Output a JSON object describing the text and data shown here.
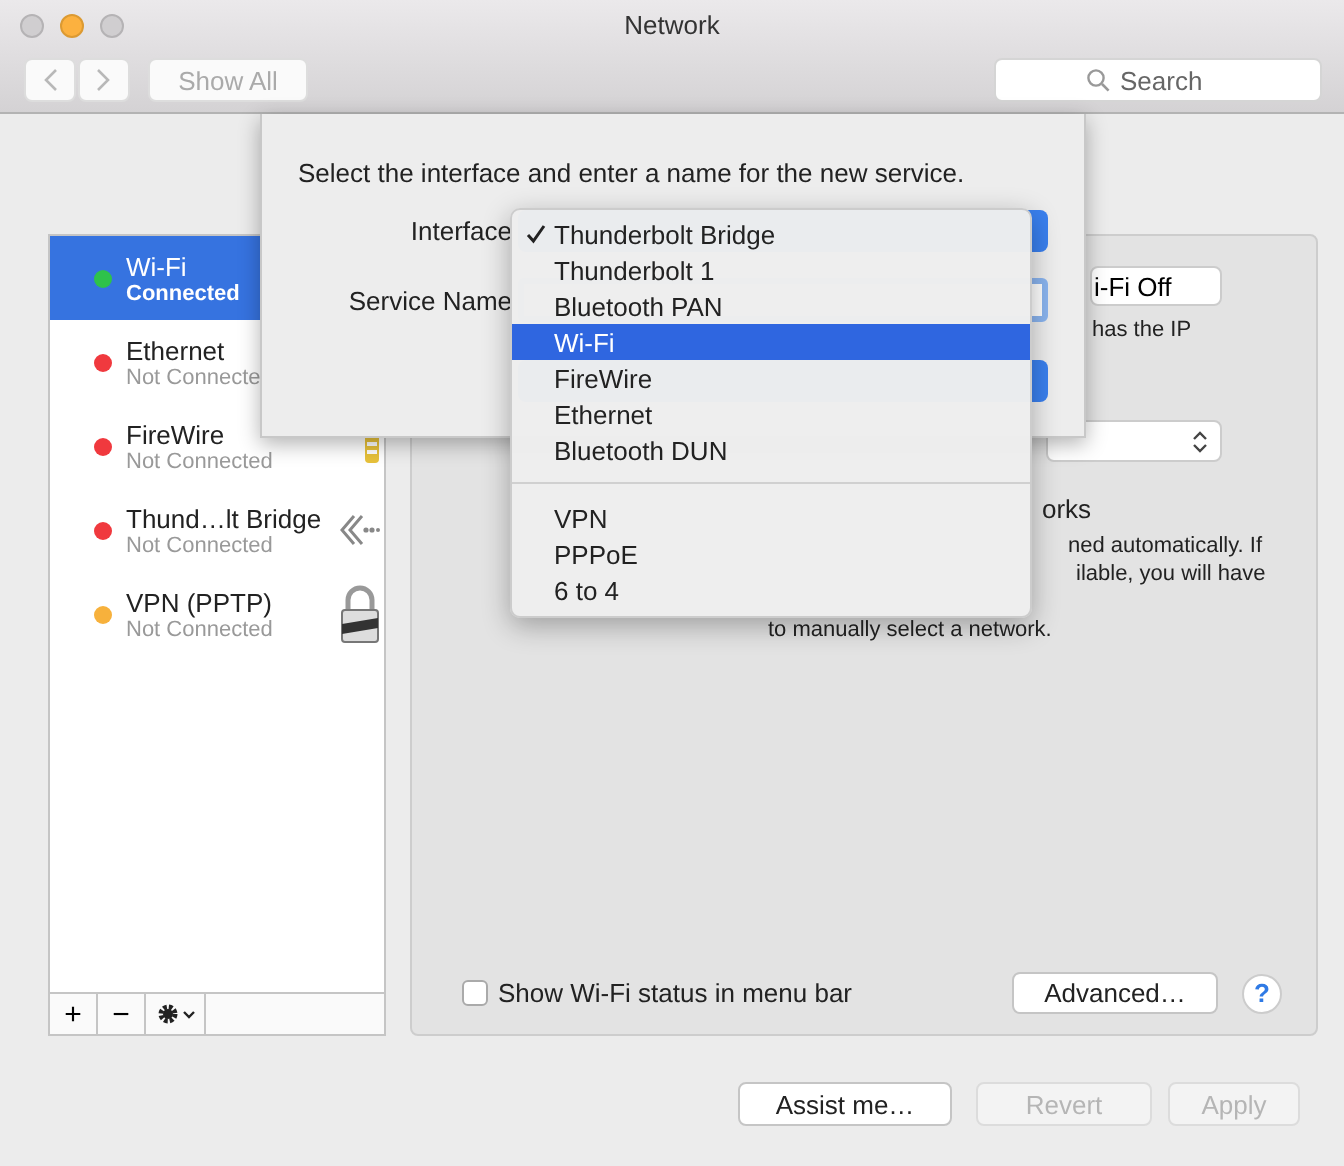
{
  "window": {
    "title": "Network"
  },
  "toolbar": {
    "show_all": "Show All",
    "search_placeholder": "Search"
  },
  "services": [
    {
      "name": "Wi-Fi",
      "status": "Connected",
      "color": "#2ec24a",
      "selected": true,
      "kind": "plain"
    },
    {
      "name": "Ethernet",
      "status": "Not Connecte",
      "color": "#f0393e",
      "selected": false,
      "kind": "plain"
    },
    {
      "name": "FireWire",
      "status": "Not Connected",
      "color": "#f0393e",
      "selected": false,
      "kind": "firewire"
    },
    {
      "name": "Thund…lt Bridge",
      "status": "Not Connected",
      "color": "#f0393e",
      "selected": false,
      "kind": "bridge"
    },
    {
      "name": "VPN (PPTP)",
      "status": "Not Connected",
      "color": "#f7b13c",
      "selected": false,
      "kind": "vpn"
    }
  ],
  "list_tools": [
    "+",
    "−"
  ],
  "panel": {
    "wifi_button": "i-Fi Off",
    "status_fragment": "has the IP",
    "heading_fragment": "orks",
    "note_lines": [
      "ned automatically. If",
      "ilable, you will have",
      "to manually select a network."
    ],
    "show_status": {
      "label": "Show Wi-Fi status in menu bar",
      "checked": false
    },
    "advanced": "Advanced…",
    "help": "?"
  },
  "buttons": [
    {
      "label": "Assist me…",
      "disabled": false
    },
    {
      "label": "Revert",
      "disabled": true
    },
    {
      "label": "Apply",
      "disabled": true
    }
  ],
  "sheet": {
    "prompt": "Select the interface and enter a name for the new service.",
    "interface_label": "Interface",
    "service_name_label": "Service Name"
  },
  "menu": {
    "groups": [
      [
        {
          "label": "Thunderbolt Bridge",
          "checked": true,
          "selected": false
        },
        {
          "label": "Thunderbolt 1",
          "checked": false,
          "selected": false
        },
        {
          "label": "Bluetooth PAN",
          "checked": false,
          "selected": false
        },
        {
          "label": "Wi-Fi",
          "checked": false,
          "selected": true
        },
        {
          "label": "FireWire",
          "checked": false,
          "selected": false
        },
        {
          "label": "Ethernet",
          "checked": false,
          "selected": false
        },
        {
          "label": "Bluetooth DUN",
          "checked": false,
          "selected": false
        }
      ],
      [
        {
          "label": "VPN",
          "checked": false,
          "selected": false
        },
        {
          "label": "PPPoE",
          "checked": false,
          "selected": false
        },
        {
          "label": "6 to 4",
          "checked": false,
          "selected": false
        }
      ]
    ]
  }
}
